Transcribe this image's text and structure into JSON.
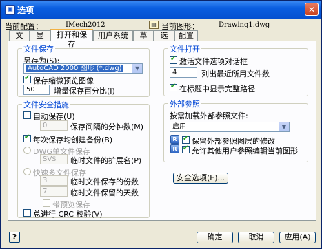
{
  "window": {
    "title": "选项",
    "close": "✕"
  },
  "header": {
    "profile_label": "当前配置：",
    "profile_value": "IMech2012",
    "drawing_label": "当前图形：",
    "drawing_value": "Drawing1.dwg"
  },
  "tabs": [
    "文件",
    "显示",
    "打开和保存",
    "用户系统配置",
    "草图",
    "选择",
    "配置"
  ],
  "active_tab": "打开和保存",
  "file_save": {
    "title": "文件保存",
    "save_as_label": "另存为(S):",
    "save_as_value": "AutoCAD 2000 图形 (*.dwg)",
    "save_thumbnail": {
      "label": "保存缩微预览图像",
      "checked": true
    },
    "incremental_value": "50",
    "incremental_label": "增量保存百分比(I)"
  },
  "file_safety": {
    "title": "文件安全措施",
    "autosave": {
      "label": "自动保存(U)",
      "checked": false
    },
    "autosave_minutes_value": "0",
    "autosave_minutes_label": "保存间隔的分钟数(M)",
    "backup": {
      "label": "每次保存均创建备份(B)",
      "checked": true
    },
    "dwg_single_label": "DWG单文件保存",
    "temp_ext_value": "SV$",
    "temp_ext_label": "临时文件的扩展名(P)",
    "quick_multi_label": "快速多文件保存",
    "temp_copies_value": "3",
    "temp_copies_label": "临时文件保存的份数",
    "temp_days_value": "7",
    "temp_days_label": "临时文件保留的天数",
    "preview_save": {
      "label": "带预览保存",
      "checked": false
    },
    "crc": {
      "label": "总进行 CRC 校验(V)",
      "checked": false
    }
  },
  "file_open": {
    "title": "文件打开",
    "activate_dialog": {
      "label": "激活文件选项对话框",
      "checked": true
    },
    "recent_value": "4",
    "recent_label": "列出最近所用文件数",
    "full_path": {
      "label": "在标题中显示完整路径",
      "checked": true
    }
  },
  "xref": {
    "title": "外部参照",
    "demand_load_label": "按需加载外部参照文件:",
    "demand_load_value": "启用",
    "retain_changes": {
      "label": "保留外部参照图层的修改",
      "checked": true
    },
    "allow_edit": {
      "label": "允许其他用户参照编辑当前图形",
      "checked": true
    }
  },
  "buttons": {
    "security": "安全选项(E)...",
    "ok": "确定",
    "cancel": "取消",
    "apply": "应用(A)",
    "help": "?"
  },
  "icons": {
    "dropdown": "chevron-down-icon",
    "xref": "xref-file-icon",
    "drawing": "drawing-file-icon"
  }
}
